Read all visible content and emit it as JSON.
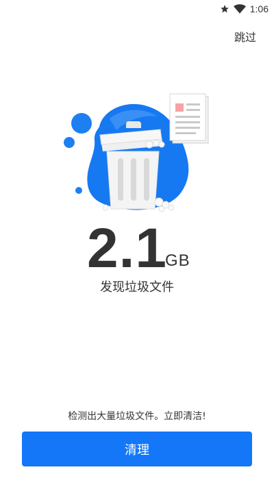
{
  "status_bar": {
    "time": "1:06",
    "icons": [
      "star-icon",
      "wifi-icon"
    ]
  },
  "header": {
    "skip_label": "跳过"
  },
  "junk": {
    "size_value": "2.1",
    "size_unit": "GB",
    "found_label": "发现垃圾文件"
  },
  "footer": {
    "hint_text": "检测出大量垃圾文件。立即清洁!",
    "clean_label": "清理"
  },
  "colors": {
    "accent": "#1477f8",
    "blob_light": "#3a8ff7",
    "text": "#333333"
  }
}
